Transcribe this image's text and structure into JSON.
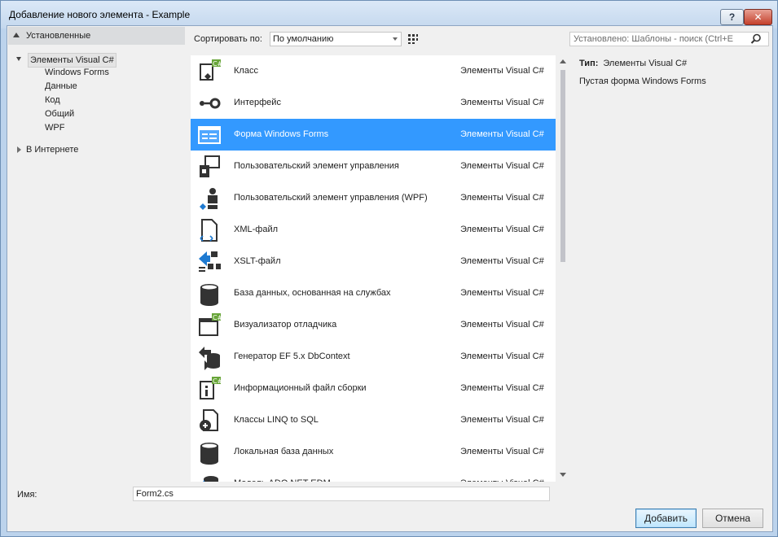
{
  "window": {
    "title": "Добавление нового элемента - Example",
    "help_label": "?",
    "close_label": "✕"
  },
  "left_pane": {
    "installed_header": "Установленные",
    "root_item": "Элементы Visual C#",
    "children": [
      "Windows Forms",
      "Данные",
      "Код",
      "Общий",
      "WPF"
    ],
    "online_item": "В Интернете"
  },
  "toolbar": {
    "sort_label": "Сортировать по:",
    "sort_value": "По умолчанию",
    "search_placeholder": "Установлено: Шаблоны - поиск (Ctrl+E"
  },
  "items": [
    {
      "name": "Класс",
      "category": "Элементы Visual C#",
      "icon": "class-icon"
    },
    {
      "name": "Интерфейс",
      "category": "Элементы Visual C#",
      "icon": "interface-icon"
    },
    {
      "name": "Форма Windows Forms",
      "category": "Элементы Visual C#",
      "icon": "form-icon",
      "selected": true
    },
    {
      "name": "Пользовательский элемент управления",
      "category": "Элементы Visual C#",
      "icon": "user-control-icon"
    },
    {
      "name": "Пользовательский элемент управления (WPF)",
      "category": "Элементы Visual C#",
      "icon": "wpf-user-control-icon"
    },
    {
      "name": "XML-файл",
      "category": "Элементы Visual C#",
      "icon": "xml-file-icon"
    },
    {
      "name": "XSLT-файл",
      "category": "Элементы Visual C#",
      "icon": "xslt-file-icon"
    },
    {
      "name": "База данных, основанная на службах",
      "category": "Элементы Visual C#",
      "icon": "database-icon"
    },
    {
      "name": "Визуализатор отладчика",
      "category": "Элементы Visual C#",
      "icon": "debugger-visualizer-icon"
    },
    {
      "name": "Генератор EF 5.x DbContext",
      "category": "Элементы Visual C#",
      "icon": "ef-generator-icon"
    },
    {
      "name": "Информационный файл сборки",
      "category": "Элементы Visual C#",
      "icon": "assembly-info-icon"
    },
    {
      "name": "Классы LINQ to SQL",
      "category": "Элементы Visual C#",
      "icon": "linq-icon"
    },
    {
      "name": "Локальная база данных",
      "category": "Элементы Visual C#",
      "icon": "local-database-icon"
    },
    {
      "name": "Модель ADO.NET EDM",
      "category": "Элементы Visual C#",
      "icon": "ado-model-icon"
    }
  ],
  "details": {
    "type_label": "Тип:",
    "type_value": "Элементы Visual C#",
    "description": "Пустая форма Windows Forms"
  },
  "bottom": {
    "name_label": "Имя:",
    "name_value": "Form2.cs",
    "add_button": "Добавить",
    "cancel_button": "Отмена"
  },
  "colors": {
    "selection": "#3399ff",
    "csharp_badge": "#68a539",
    "icon_dark": "#333333"
  }
}
